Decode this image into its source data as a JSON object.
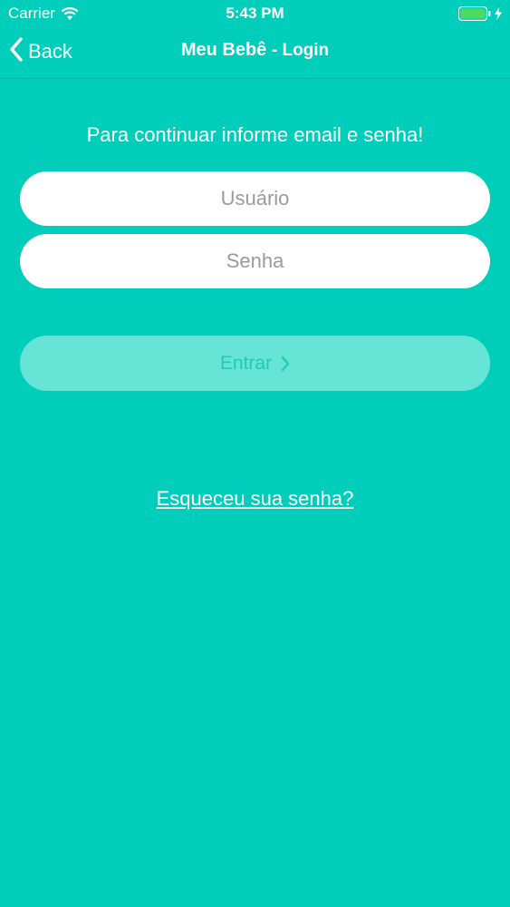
{
  "status_bar": {
    "carrier": "Carrier",
    "time": "5:43 PM",
    "icons": [
      "wifi-icon",
      "battery-icon",
      "charging-icon"
    ]
  },
  "nav": {
    "back_label": "Back",
    "title": "Meu Bebê",
    "title_suffix": "- Login"
  },
  "form": {
    "instruction": "Para continuar informe email e senha!",
    "username_placeholder": "Usuário",
    "username_value": "",
    "password_placeholder": "Senha",
    "password_value": "",
    "submit_label": "Entrar",
    "forgot_password_label": "Esqueceu sua senha?"
  },
  "colors": {
    "background": "#00CDBA",
    "button_disabled": "#66E4D5",
    "button_text": "#22C9B6",
    "text": "#FFFFFF",
    "battery": "#4CD964"
  }
}
